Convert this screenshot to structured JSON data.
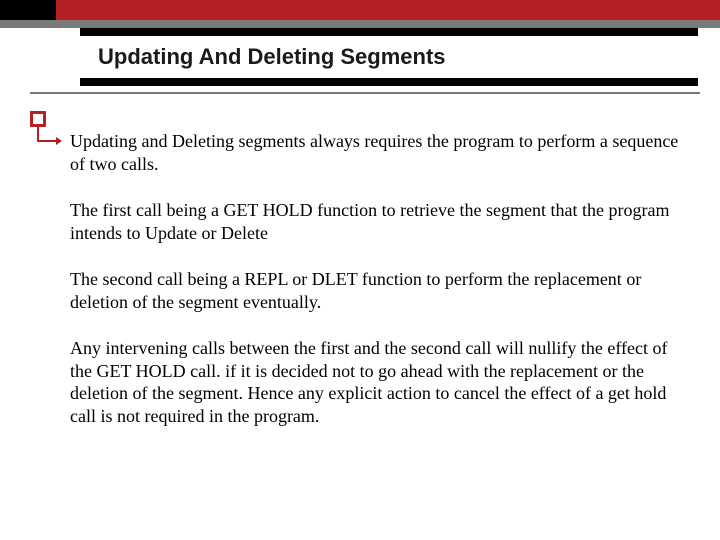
{
  "title": "Updating And Deleting Segments",
  "paragraphs": {
    "p1": "Updating and Deleting segments always requires the program to perform a sequence of two calls.",
    "p2": "The first call being a GET HOLD function to retrieve the segment that the program intends to Update or Delete",
    "p3": "The second call being a REPL or DLET function to perform the replacement or deletion of the segment eventually.",
    "p4": "Any intervening calls between the first and the second call will nullify the effect of the GET HOLD call. if it is decided not to go ahead with the replacement or the deletion of the segment. Hence any explicit action to cancel the effect of a get hold call is not required in the program."
  }
}
